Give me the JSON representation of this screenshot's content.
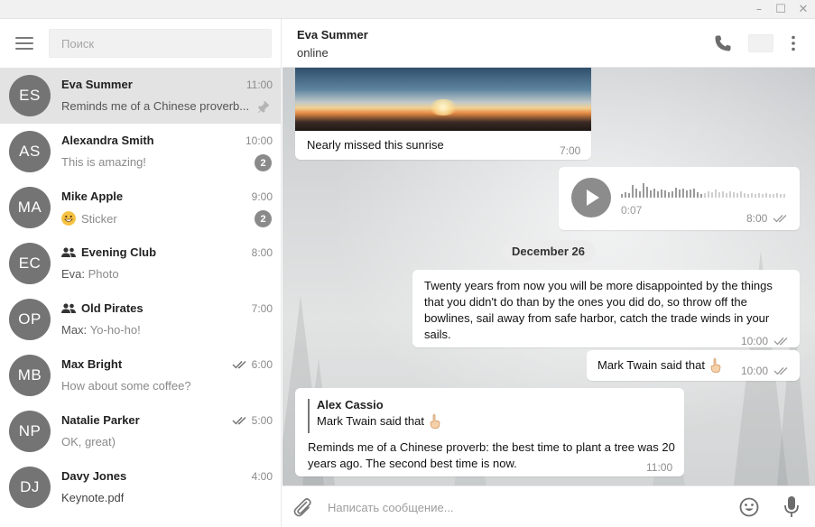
{
  "window": {
    "minimize_glyph": "–",
    "maximize_glyph": "☐",
    "close_glyph": "✕"
  },
  "sidebar": {
    "search_placeholder": "Поиск",
    "chats": [
      {
        "initials": "ES",
        "name": "Eva Summer",
        "time": "11:00",
        "preview": "Reminds me of a Chinese proverb...",
        "pinned": true,
        "active": true
      },
      {
        "initials": "AS",
        "name": "Alexandra Smith",
        "time": "10:00",
        "preview": "This is amazing!",
        "badge": "2"
      },
      {
        "initials": "MA",
        "name": "Mike Apple",
        "time": "9:00",
        "preview": "Sticker",
        "badge": "2",
        "preview_emoji": "grinning-face"
      },
      {
        "initials": "EC",
        "name": "Evening Club",
        "time": "8:00",
        "sender": "Eva:",
        "preview": "Photo",
        "group": true
      },
      {
        "initials": "OP",
        "name": "Old Pirates",
        "time": "7:00",
        "sender": "Max:",
        "preview": "Yo-ho-ho!",
        "group": true
      },
      {
        "initials": "MB",
        "name": "Max Bright",
        "time": "6:00",
        "preview": "How about some coffee?",
        "read": true
      },
      {
        "initials": "NP",
        "name": "Natalie Parker",
        "time": "5:00",
        "preview": "OK, great)",
        "read": true
      },
      {
        "initials": "DJ",
        "name": "Davy Jones",
        "time": "4:00",
        "preview": "Keynote.pdf"
      }
    ]
  },
  "header": {
    "name": "Eva Summer",
    "status": "online"
  },
  "messages": {
    "photo": {
      "caption": "Nearly missed this sunrise",
      "time": "7:00"
    },
    "voice": {
      "duration": "0:07",
      "time": "8:00"
    },
    "date": "December 26",
    "quote": {
      "text": "Twenty years from now you will be more disappointed by the things that you didn't do than by the ones you did do, so throw off the bowlines, sail away from safe harbor, catch the trade winds in your sails.",
      "time": "10:00"
    },
    "twain": {
      "text": "Mark Twain said that",
      "time": "10:00"
    },
    "reply": {
      "author": "Alex Cassio",
      "quoted": "Mark Twain said that",
      "text": "Reminds me of a Chinese proverb: the best time to plant a tree was 20 years ago. The second best time is now.",
      "time": "11:00"
    }
  },
  "composer": {
    "placeholder": "Написать сообщение..."
  },
  "icons": {
    "menu": "hamburger-icon",
    "phone": "phone-icon",
    "search": "search-icon",
    "more": "more-vertical-icon",
    "attach": "paperclip-icon",
    "emoji": "smile-icon",
    "mic": "microphone-icon",
    "pin": "pin-icon",
    "group": "group-icon",
    "read": "double-check-icon"
  },
  "colors": {
    "avatar": "#747474",
    "active_chat": "#e3e3e3",
    "badge": "#8a8a8a"
  }
}
